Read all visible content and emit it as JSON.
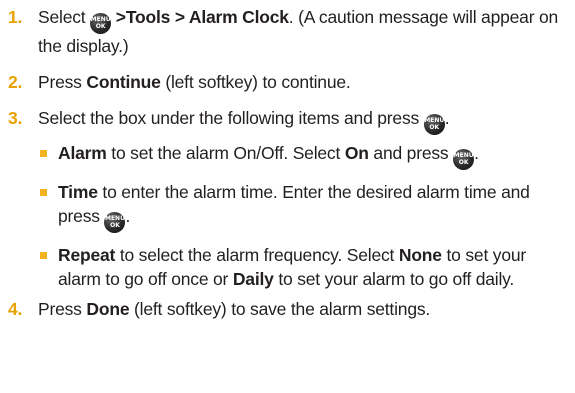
{
  "steps": [
    {
      "num": "1.",
      "pre": "Select",
      "path": ">Tools > Alarm Clock",
      "post": ". (A caution message will appear on the display.)"
    },
    {
      "num": "2.",
      "pre": "Press",
      "bold": "Continue",
      "post": "(left softkey) to continue."
    },
    {
      "num": "3.",
      "text": "Select the box under the following items and press",
      "end": ".",
      "subitems": [
        {
          "bold": "Alarm",
          "text": "to set the alarm On/Off. Select",
          "bold2": "On",
          "text2": "and press",
          "end": "."
        },
        {
          "bold": "Time",
          "text": "to enter the alarm time. Enter the desired alarm time and press",
          "end": "."
        },
        {
          "bold": "Repeat",
          "text": "to select the alarm frequency. Select",
          "bold2": "None",
          "text2": "to set your alarm to go off once or",
          "bold3": "Daily",
          "text3": "to set your alarm to go off daily."
        }
      ]
    },
    {
      "num": "4.",
      "pre": "Press",
      "bold": "Done",
      "post": "(left softkey) to save the alarm settings."
    }
  ],
  "icon": {
    "name": "menu-ok-key-icon",
    "line1": "MENU",
    "line2": "OK"
  }
}
